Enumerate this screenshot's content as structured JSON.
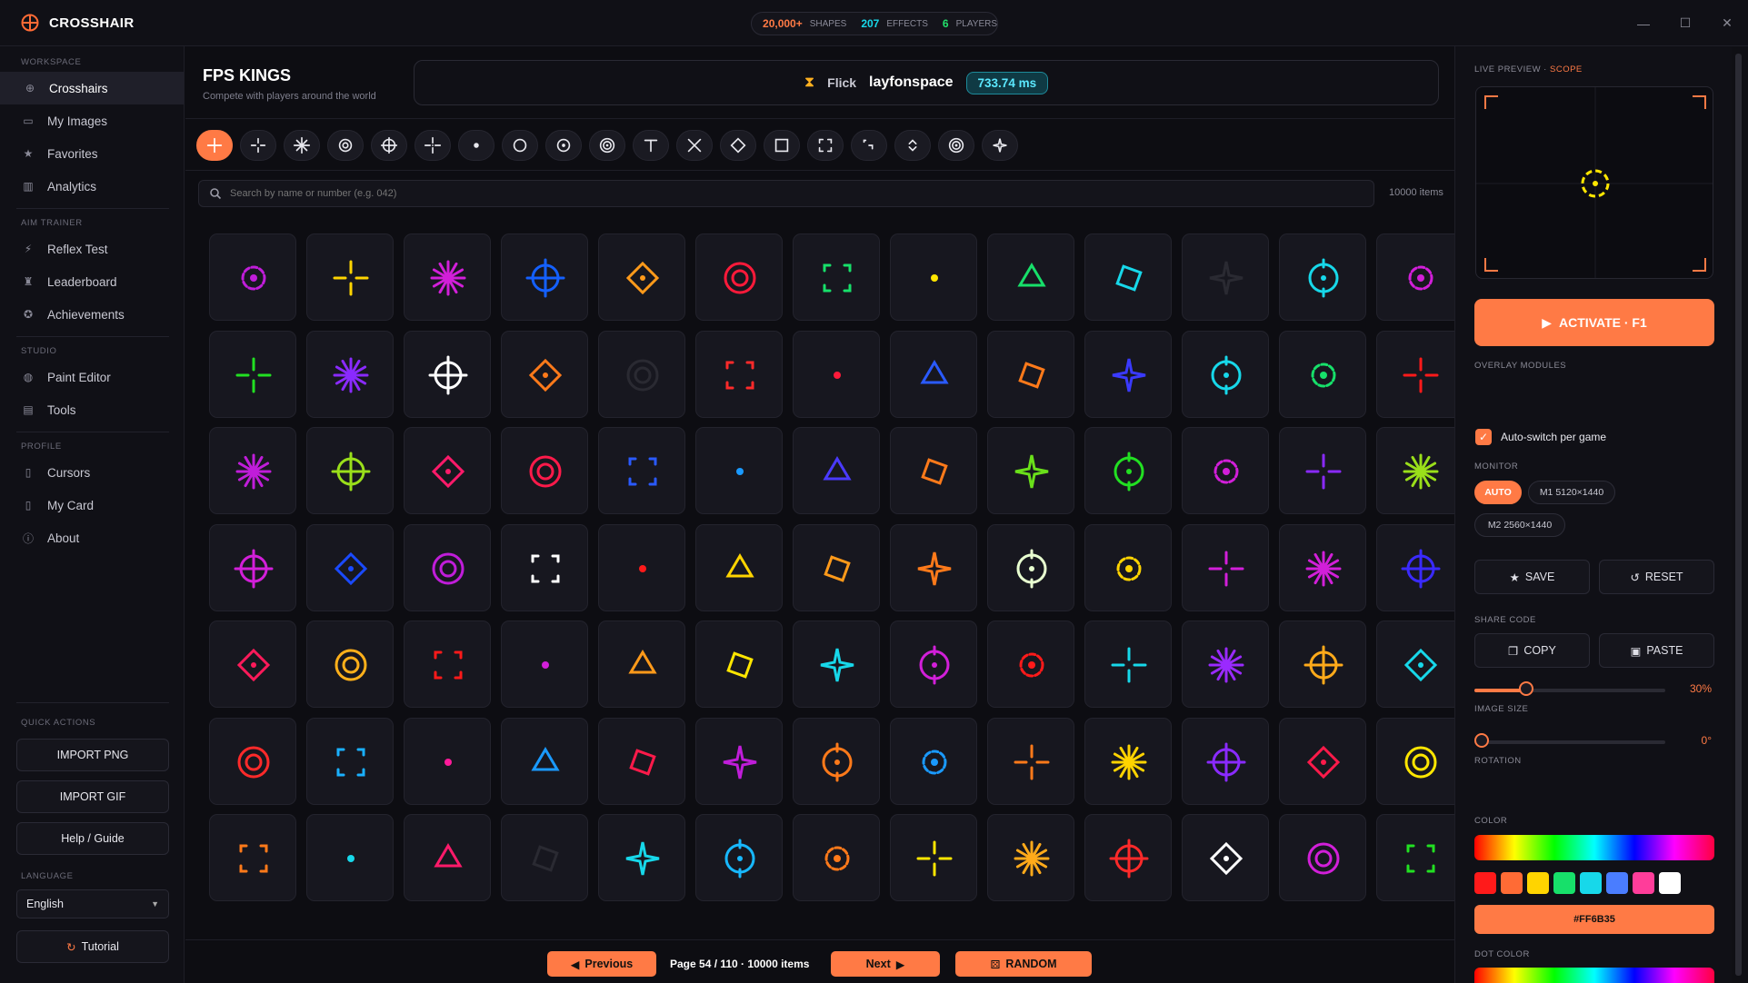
{
  "app": {
    "name": "CROSSHAIR"
  },
  "stats": {
    "shapes_value": "20,000+",
    "shapes_label": "SHAPES",
    "effects_value": "207",
    "effects_label": "EFFECTS",
    "players_value": "6",
    "players_label": "PLAYERS"
  },
  "sidebar": {
    "workspace": "WORKSPACE",
    "aim": "AIM TRAINER",
    "studio": "STUDIO",
    "profile": "PROFILE",
    "quick": "QUICK ACTIONS",
    "language": "LANGUAGE",
    "items": [
      {
        "label": "Crosshairs",
        "icon": "crosshair-icon",
        "active": true
      },
      {
        "label": "My Images",
        "icon": "image-icon"
      },
      {
        "label": "Favorites",
        "icon": "star-icon"
      },
      {
        "label": "Analytics",
        "icon": "chart-icon"
      },
      {
        "label": "Reflex Test",
        "icon": "bolt-icon"
      },
      {
        "label": "Leaderboard",
        "icon": "trophy-icon"
      },
      {
        "label": "Achievements",
        "icon": "medal-icon"
      },
      {
        "label": "Paint Editor",
        "icon": "palette-icon"
      },
      {
        "label": "Tools",
        "icon": "toolbox-icon"
      },
      {
        "label": "Cursors",
        "icon": "cursor-icon"
      },
      {
        "label": "My Card",
        "icon": "card-icon"
      },
      {
        "label": "About",
        "icon": "info-icon"
      }
    ],
    "import_png": "IMPORT PNG",
    "import_gif": "IMPORT GIF",
    "help": "Help / Guide",
    "lang_value": "English",
    "tutorial": "Tutorial"
  },
  "header": {
    "title": "FPS KINGS",
    "subtitle": "Compete with players around the world",
    "mode": "Flick",
    "user": "layfonspace",
    "score": "733.74 ms"
  },
  "search": {
    "placeholder": "Search by name or number (e.g. 042)",
    "count": "10000 items"
  },
  "footer": {
    "prev": "Previous",
    "page": "Page 54 / 110  ·  10000 items",
    "next": "Next",
    "random": "RANDOM"
  },
  "right": {
    "preview_label": "LIVE PREVIEW · ",
    "preview_mode": "SCOPE",
    "activate": "ACTIVATE  ·  F1",
    "overlay": "OVERLAY MODULES",
    "autoswitch": "Auto-switch per game",
    "monitor": "MONITOR",
    "mon_auto": "AUTO",
    "mon_1": "M1  5120×1440",
    "mon_2": "M2  2560×1440",
    "save": "SAVE",
    "reset": "RESET",
    "share": "SHARE CODE",
    "copy": "COPY",
    "paste": "PASTE",
    "imgsize": "IMAGE SIZE",
    "imgsize_val": "30%",
    "rotation": "ROTATION",
    "rotation_val": "0°",
    "color": "COLOR",
    "hex": "#FF6B35",
    "dotcolor": "DOT COLOR",
    "dothex": "#FFFFFF",
    "swatches": [
      "#ff1a1a",
      "#ff6b35",
      "#ffd400",
      "#17e06a",
      "#17d8ea",
      "#4a7dff",
      "#ff3d9a",
      "#ffffff"
    ],
    "accent": "#ff7a45"
  },
  "shape_filters": [
    "plus",
    "cross-gap",
    "burst",
    "ring-dot",
    "circle-cross",
    "gap-cross",
    "dot",
    "circle",
    "circle-dot",
    "double-ring",
    "t-shape",
    "x-shape",
    "diamond",
    "square",
    "brackets",
    "corner",
    "chevrons",
    "target",
    "sparkle"
  ],
  "grid": [
    [
      "#c01dd9",
      "#ffd400",
      "#d21fd9",
      "#1460ff",
      "#ff9a1a",
      "#ff1a3a",
      "#17e06a",
      "#ffe600",
      "#17e06a",
      "#17d8ea",
      "#2a2a32",
      "#17d8ea",
      "#d21fd9"
    ],
    [
      "#22e022",
      "#8a2aff",
      "#ffffff",
      "#ff7a1a",
      "#2a2a32",
      "#ff2a2a",
      "#ff1a3a",
      "#2a5aff",
      "#ff7a1a",
      "#3a3aff",
      "#17d8ea",
      "#17e06a",
      "#ff1a1a"
    ],
    [
      "#c01dd9",
      "#9adf1a",
      "#ff1a6a",
      "#ff1a4a",
      "#2a5aff",
      "#1a9aff",
      "#4a3aff",
      "#ff7a1a",
      "#6ae01a",
      "#22e022",
      "#d21fd9",
      "#8a2aff",
      "#9adf1a"
    ],
    [
      "#d21fd9",
      "#1a4aff",
      "#c01dd9",
      "#ffffff",
      "#ff1a1a",
      "#ffd400",
      "#ff9a1a",
      "#ff7a1a",
      "#e8ffd0",
      "#ffd400",
      "#d21fd9",
      "#d21fd9",
      "#3a2aff"
    ],
    [
      "#ff1a5a",
      "#ffb01a",
      "#ff1a1a",
      "#d21fd9",
      "#ff9a1a",
      "#ffe600",
      "#17d8ea",
      "#d21fd9",
      "#ff1a1a",
      "#17d8ea",
      "#9a2aff",
      "#ffaa1a",
      "#17d8ea"
    ],
    [
      "#ff2a2a",
      "#1ab0ff",
      "#ff1a9a",
      "#1a9aff",
      "#ff1a4a",
      "#c01dd9",
      "#ff7a1a",
      "#1a9aff",
      "#ff7a1a",
      "#ffd400",
      "#8a2aff",
      "#ff1a4a",
      "#ffe600"
    ],
    [
      "#ff7a1a",
      "#17d8ea",
      "#ff1a6a",
      "#2a2a32",
      "#17d8ea",
      "#17b8ff",
      "#ff7a1a",
      "#ffe600",
      "#ffaa1a",
      "#ff2a2a",
      "#ffffff",
      "#d21fd9",
      "#22e022"
    ]
  ]
}
